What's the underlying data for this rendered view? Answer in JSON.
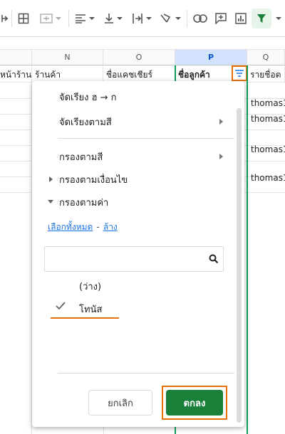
{
  "toolbar": {
    "icons": [
      "merge-cells-icon",
      "borders-icon",
      "align-left-icon",
      "valign-bottom-icon",
      "text-wrap-icon",
      "text-rotate-icon",
      "link-icon",
      "comment-icon",
      "chart-icon",
      "filter-icon"
    ]
  },
  "sheet": {
    "columns": [
      "N",
      "O",
      "P",
      "Q"
    ],
    "headers": {
      "m_partial": "หน้าร้าน",
      "n": "ร้านค้า",
      "o": "ชื่อแคชเชียร์",
      "p": "ชื่อลูกค้า",
      "q_partial": "รายชื่อต"
    },
    "q_cells": [
      "thomas1",
      "thomas1",
      "thomas1",
      "thomas1"
    ]
  },
  "filter_menu": {
    "sort_z_a": "จัดเรียง ฮ → ก",
    "sort_by_color": "จัดเรียงตามสี",
    "filter_by_color": "กรองตามสี",
    "filter_by_condition": "กรองตามเงื่อนไข",
    "filter_by_values": "กรองตามค่า",
    "select_all": "เลือกทั้งหมด",
    "link_separator": "-",
    "clear": "ล้าง",
    "search_placeholder": "",
    "values": [
      {
        "label": "(ว่าง)",
        "checked": false
      },
      {
        "label": "โทนัส",
        "checked": true
      }
    ],
    "cancel_label": "ยกเลิก",
    "ok_label": "ตกลง"
  },
  "colors": {
    "accent_green": "#188038",
    "highlight_orange": "#e8710a",
    "link_blue": "#1a73e8"
  }
}
